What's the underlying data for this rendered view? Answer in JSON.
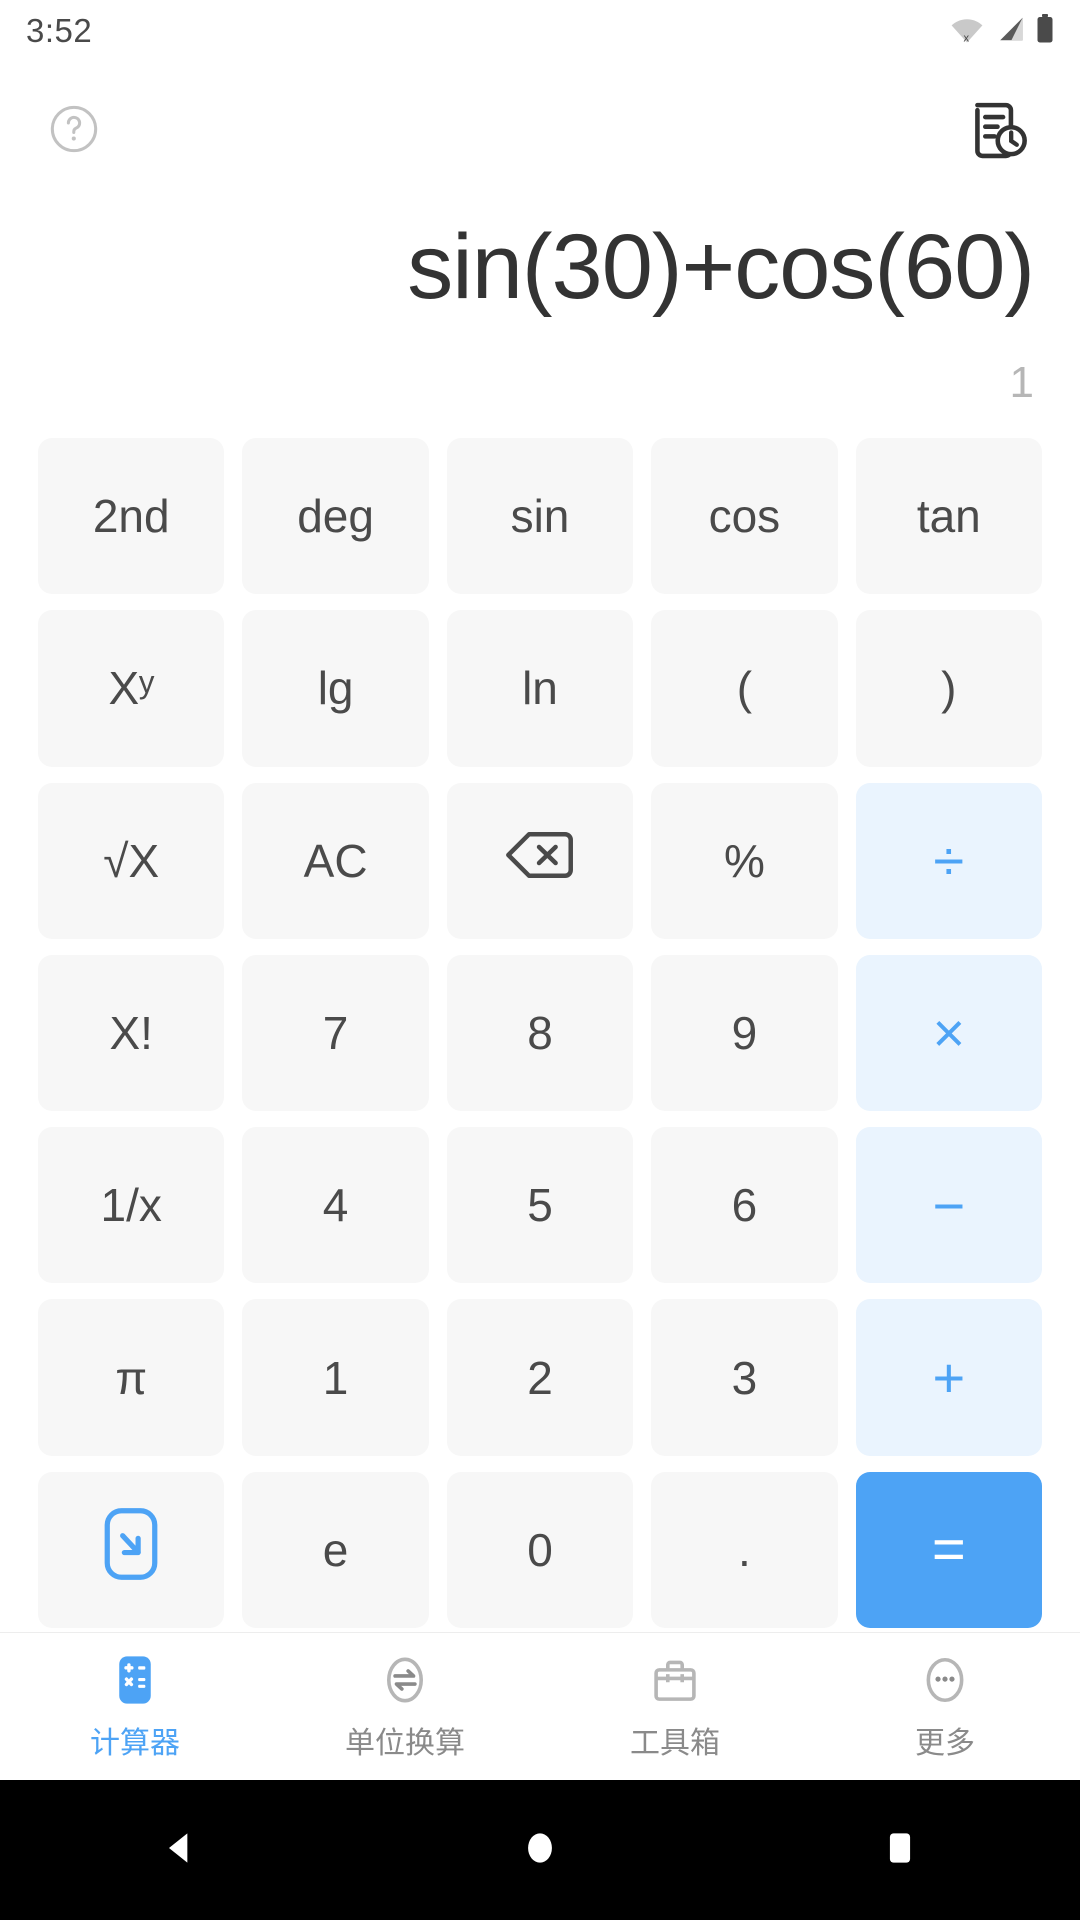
{
  "status_bar": {
    "time": "3:52",
    "icons": [
      "wifi-off-icon",
      "signal-icon",
      "battery-icon"
    ]
  },
  "top_bar": {
    "help_icon": "help-circle-icon",
    "history_icon": "history-document-icon"
  },
  "display": {
    "expression": "sin(30)+cos(60)",
    "result": "1"
  },
  "colors": {
    "accent": "#4da3f5",
    "operator_bg": "#eaf4fe",
    "key_bg": "#f7f7f7",
    "text": "#4a4a4a",
    "expression_text": "#333333",
    "result_text": "#b6b6b6"
  },
  "keypad": {
    "rows": [
      [
        {
          "label": "2nd",
          "name": "key-2nd",
          "style": "normal"
        },
        {
          "label": "deg",
          "name": "key-deg",
          "style": "normal"
        },
        {
          "label": "sin",
          "name": "key-sin",
          "style": "normal"
        },
        {
          "label": "cos",
          "name": "key-cos",
          "style": "normal"
        },
        {
          "label": "tan",
          "name": "key-tan",
          "style": "normal"
        }
      ],
      [
        {
          "label": "Xʸ",
          "name": "key-power",
          "style": "normal"
        },
        {
          "label": "lg",
          "name": "key-lg",
          "style": "normal"
        },
        {
          "label": "ln",
          "name": "key-ln",
          "style": "normal"
        },
        {
          "label": "(",
          "name": "key-open-paren",
          "style": "normal"
        },
        {
          "label": ")",
          "name": "key-close-paren",
          "style": "normal"
        }
      ],
      [
        {
          "label": "√X",
          "name": "key-sqrt",
          "style": "normal"
        },
        {
          "label": "AC",
          "name": "key-ac",
          "style": "normal"
        },
        {
          "label": "",
          "name": "key-backspace",
          "style": "icon-backspace"
        },
        {
          "label": "%",
          "name": "key-percent",
          "style": "normal"
        },
        {
          "label": "÷",
          "name": "key-divide",
          "style": "op"
        }
      ],
      [
        {
          "label": "X!",
          "name": "key-factorial",
          "style": "normal"
        },
        {
          "label": "7",
          "name": "key-7",
          "style": "normal"
        },
        {
          "label": "8",
          "name": "key-8",
          "style": "normal"
        },
        {
          "label": "9",
          "name": "key-9",
          "style": "normal"
        },
        {
          "label": "×",
          "name": "key-multiply",
          "style": "op"
        }
      ],
      [
        {
          "label": "1/x",
          "name": "key-reciprocal",
          "style": "normal"
        },
        {
          "label": "4",
          "name": "key-4",
          "style": "normal"
        },
        {
          "label": "5",
          "name": "key-5",
          "style": "normal"
        },
        {
          "label": "6",
          "name": "key-6",
          "style": "normal"
        },
        {
          "label": "−",
          "name": "key-minus",
          "style": "op"
        }
      ],
      [
        {
          "label": "π",
          "name": "key-pi",
          "style": "normal"
        },
        {
          "label": "1",
          "name": "key-1",
          "style": "normal"
        },
        {
          "label": "2",
          "name": "key-2",
          "style": "normal"
        },
        {
          "label": "3",
          "name": "key-3",
          "style": "normal"
        },
        {
          "label": "+",
          "name": "key-plus",
          "style": "op"
        }
      ],
      [
        {
          "label": "",
          "name": "key-collapse-keypad",
          "style": "icon-collapse"
        },
        {
          "label": "e",
          "name": "key-e",
          "style": "normal"
        },
        {
          "label": "0",
          "name": "key-0",
          "style": "normal"
        },
        {
          "label": ".",
          "name": "key-decimal",
          "style": "normal"
        },
        {
          "label": "=",
          "name": "key-equals",
          "style": "equals"
        }
      ]
    ]
  },
  "bottom_nav": {
    "items": [
      {
        "label": "计算器",
        "name": "nav-calculator",
        "icon": "calculator-icon",
        "active": true
      },
      {
        "label": "单位换算",
        "name": "nav-unit-converter",
        "icon": "convert-icon",
        "active": false
      },
      {
        "label": "工具箱",
        "name": "nav-toolbox",
        "icon": "toolbox-icon",
        "active": false
      },
      {
        "label": "更多",
        "name": "nav-more",
        "icon": "more-icon",
        "active": false
      }
    ]
  },
  "android_nav": {
    "back": "back-triangle-icon",
    "home": "home-circle-icon",
    "recents": "recents-square-icon"
  }
}
